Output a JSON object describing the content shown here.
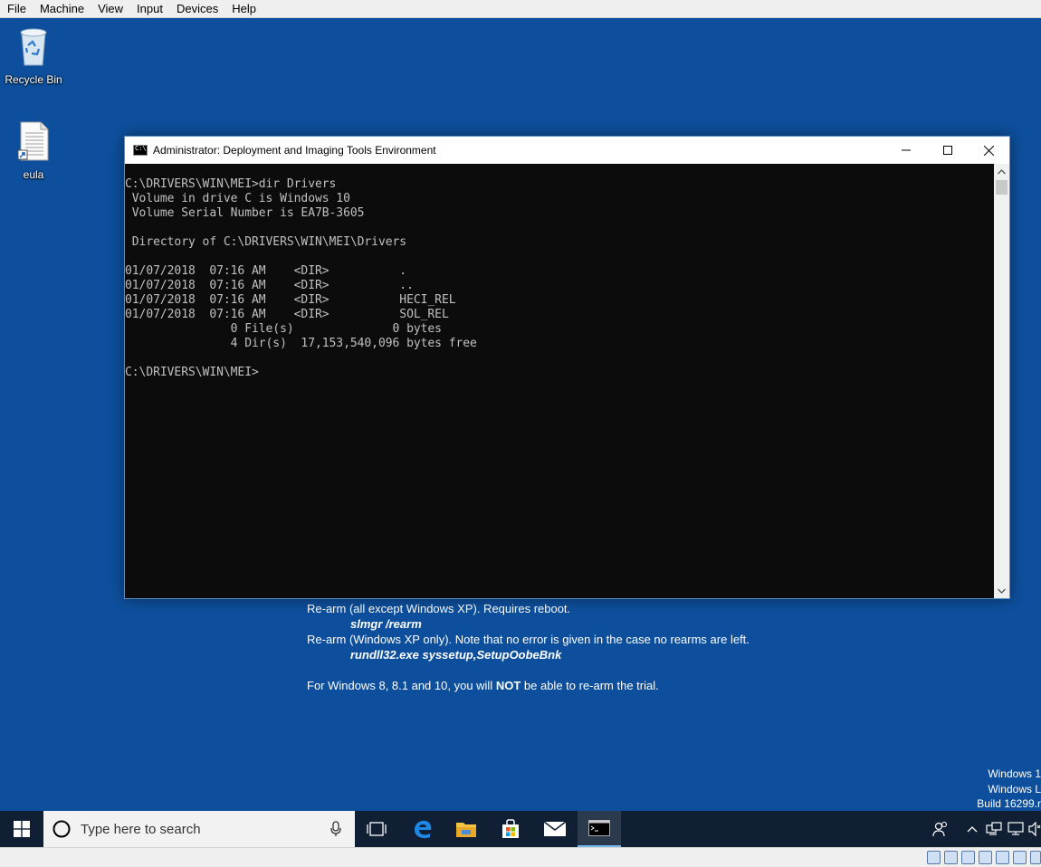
{
  "host_menu": [
    "File",
    "Machine",
    "View",
    "Input",
    "Devices",
    "Help"
  ],
  "desktop": {
    "icons": [
      {
        "label": "Recycle Bin",
        "icon": "recycle-bin-icon"
      },
      {
        "label": "eula",
        "icon": "text-document-shortcut-icon"
      }
    ],
    "background_text": {
      "rearm_all": "Re-arm (all except Windows XP). Requires reboot.",
      "cmd_slmgr": "slmgr /rearm",
      "rearm_xp": "Re-arm (Windows XP only). Note that no error is given in the case no rearms are left.",
      "cmd_rundll": "rundll32.exe syssetup,SetupOobeBnk",
      "note_prefix": "For Windows 8, 8.1 and 10, you will ",
      "note_bold": "NOT",
      "note_suffix": " be able to re-arm the trial."
    },
    "watermark": [
      "Windows 1",
      "Windows L",
      "Build 16299.r"
    ]
  },
  "console": {
    "title": "Administrator: Deployment and Imaging Tools Environment",
    "lines": [
      "C:\\DRIVERS\\WIN\\MEI>dir Drivers",
      " Volume in drive C is Windows 10",
      " Volume Serial Number is EA7B-3605",
      "",
      " Directory of C:\\DRIVERS\\WIN\\MEI\\Drivers",
      "",
      "01/07/2018  07:16 AM    <DIR>          .",
      "01/07/2018  07:16 AM    <DIR>          ..",
      "01/07/2018  07:16 AM    <DIR>          HECI_REL",
      "01/07/2018  07:16 AM    <DIR>          SOL_REL",
      "               0 File(s)              0 bytes",
      "               4 Dir(s)  17,153,540,096 bytes free",
      "",
      "C:\\DRIVERS\\WIN\\MEI>"
    ],
    "colors": {
      "background": "#0c0c0c",
      "text": "#c0c0c0"
    }
  },
  "taskbar": {
    "search_placeholder": "Type here to search",
    "pinned": [
      "task-view-icon",
      "edge-icon",
      "file-explorer-icon",
      "store-icon",
      "mail-icon",
      "command-prompt-icon"
    ],
    "active": "command-prompt-icon"
  },
  "colors": {
    "desktop": "#0d4f9c",
    "taskbar": "#101f33",
    "accent": "#76b9ed"
  }
}
